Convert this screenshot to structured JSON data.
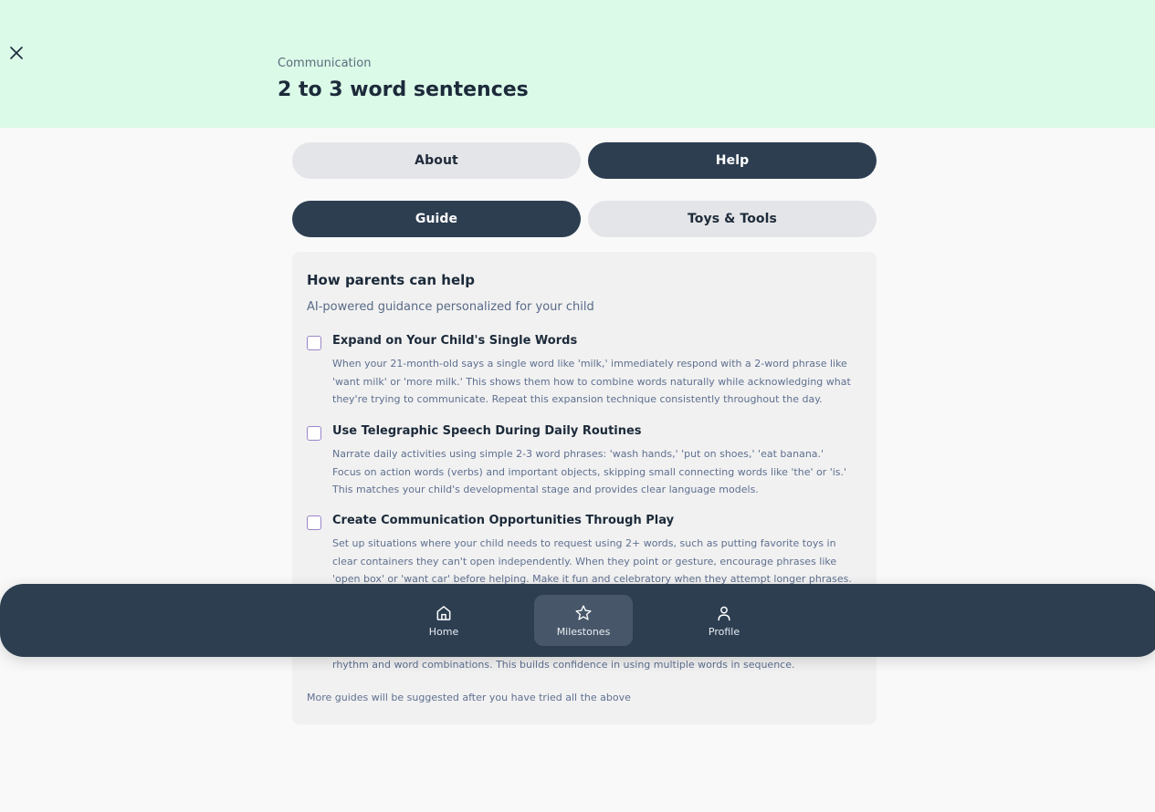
{
  "header": {
    "category": "Communication",
    "title": "2 to 3 word sentences"
  },
  "tabs_primary": [
    {
      "label": "About",
      "active": false
    },
    {
      "label": "Help",
      "active": true
    }
  ],
  "tabs_secondary": [
    {
      "label": "Guide",
      "active": true
    },
    {
      "label": "Toys & Tools",
      "active": false
    }
  ],
  "card": {
    "title": "How parents can help",
    "subtitle": "AI-powered guidance personalized for your child",
    "tips": [
      {
        "title": "Expand on Your Child's Single Words",
        "body": "When your 21-month-old says a single word like 'milk,' immediately respond with a 2-word phrase like 'want milk' or 'more milk.' This shows them how to combine words naturally while acknowledging what they're trying to communicate. Repeat this expansion technique consistently throughout the day.",
        "checked": false
      },
      {
        "title": "Use Telegraphic Speech During Daily Routines",
        "body": "Narrate daily activities using simple 2-3 word phrases: 'wash hands,' 'put on shoes,' 'eat banana.' Focus on action words (verbs) and important objects, skipping small connecting words like 'the' or 'is.' This matches your child's developmental stage and provides clear language models.",
        "checked": false
      },
      {
        "title": "Create Communication Opportunities Through Play",
        "body": "Set up situations where your child needs to request using 2+ words, such as putting favorite toys in clear containers they can't open independently. When they point or gesture, encourage phrases like 'open box' or 'want car' before helping. Make it fun and celebratory when they attempt longer phrases.",
        "checked": false
      }
    ],
    "partial_line": "rhythm and word combinations. This builds confidence in using multiple words in sequence.",
    "footer": "More guides will be suggested after you have tried all the above"
  },
  "nav": {
    "items": [
      {
        "label": "Home",
        "icon": "home-icon",
        "active": false
      },
      {
        "label": "Milestones",
        "icon": "star-icon",
        "active": true
      },
      {
        "label": "Profile",
        "icon": "user-icon",
        "active": false
      }
    ]
  },
  "colors": {
    "header_bg": "#dbfae8",
    "dark": "#2d3e51",
    "inactive_tab": "#e4e5e8",
    "checkbox_border": "#9b86c9"
  }
}
